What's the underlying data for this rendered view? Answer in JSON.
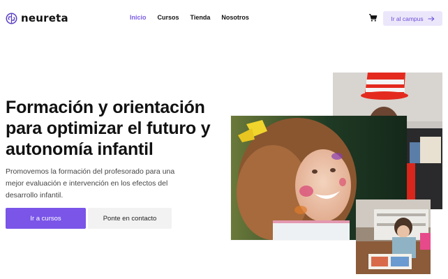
{
  "brand": {
    "name": "neureta",
    "logo_icon": "brain-logo-icon",
    "logo_color": "#5b3fc4"
  },
  "nav": {
    "items": [
      {
        "label": "Inicio",
        "active": true
      },
      {
        "label": "Cursos",
        "active": false
      },
      {
        "label": "Tienda",
        "active": false
      },
      {
        "label": "Nosotros",
        "active": false
      }
    ]
  },
  "header": {
    "cart_icon": "shopping-cart-icon",
    "campus_button": {
      "label": "Ir al campus",
      "icon": "arrow-right-icon"
    }
  },
  "hero": {
    "title": "Formación y orientación para optimizar el futuro y autonomía infantil",
    "description": "Promovemos la formación del profesorado para una mejor evaluación e intervención en los efectos del desarrollo infantil.",
    "primary_button": "Ir a cursos",
    "secondary_button": "Ponte en contacto"
  },
  "colors": {
    "accent": "#7a55e8",
    "accent_light": "#ece6fb",
    "text": "#111111",
    "muted": "#444444"
  },
  "images": [
    {
      "name": "child-with-striped-hat-photo"
    },
    {
      "name": "girl-with-painted-face-photo"
    },
    {
      "name": "child-reading-book-photo"
    }
  ]
}
